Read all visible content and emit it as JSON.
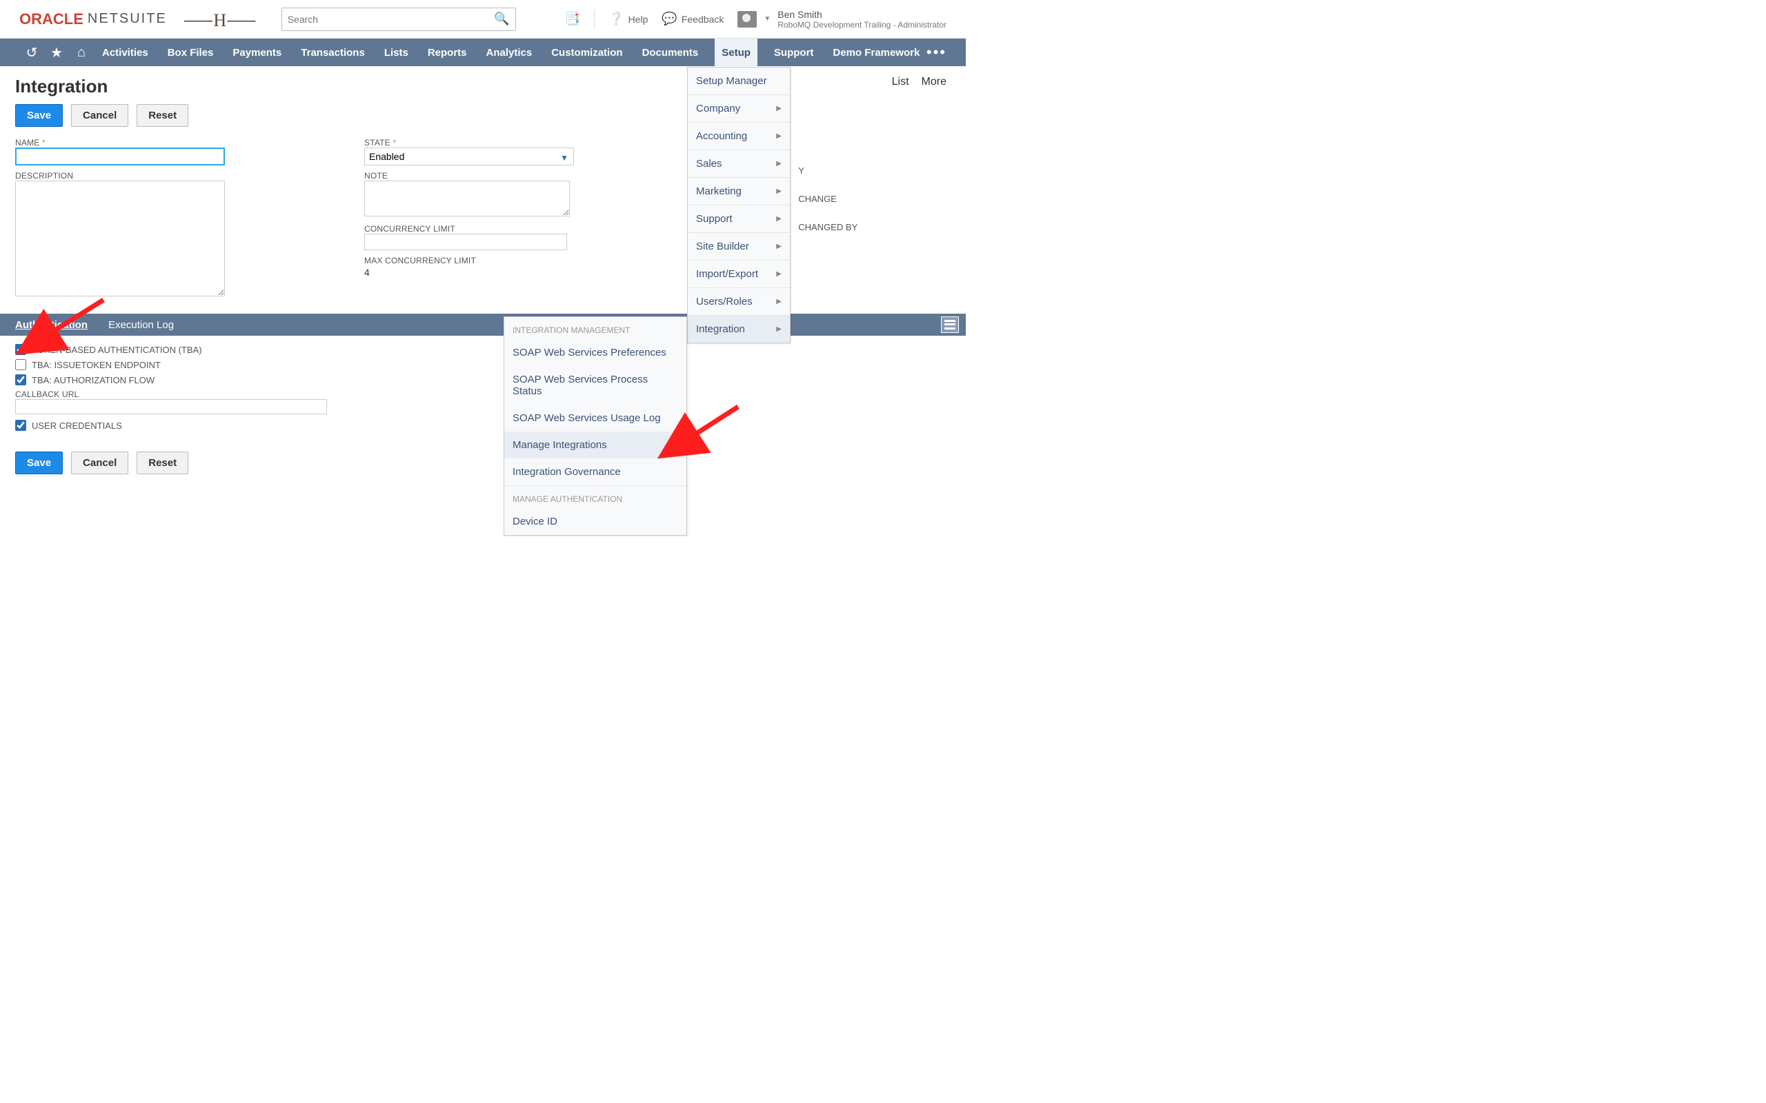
{
  "header": {
    "logo_oracle": "ORACLE",
    "logo_netsuite": "NETSUITE",
    "search_placeholder": "Search",
    "help_label": "Help",
    "feedback_label": "Feedback",
    "user_name": "Ben Smith",
    "user_role": "RoboMQ Development Trailing - Administrator"
  },
  "nav": {
    "items": [
      "Activities",
      "Box Files",
      "Payments",
      "Transactions",
      "Lists",
      "Reports",
      "Analytics",
      "Customization",
      "Documents",
      "Setup",
      "Support",
      "Demo Framework"
    ],
    "active": "Setup"
  },
  "page_title": "Integration",
  "buttons": {
    "save": "Save",
    "cancel": "Cancel",
    "reset": "Reset"
  },
  "page_actions": {
    "list": "List",
    "more": "More"
  },
  "form": {
    "name": {
      "label": "NAME",
      "value": ""
    },
    "description": {
      "label": "DESCRIPTION",
      "value": ""
    },
    "state": {
      "label": "STATE",
      "value": "Enabled"
    },
    "note": {
      "label": "NOTE",
      "value": ""
    },
    "concurrency_limit": {
      "label": "CONCURRENCY LIMIT",
      "value": ""
    },
    "max_concurrency": {
      "label": "MAX CONCURRENCY LIMIT",
      "value": "4"
    }
  },
  "shadow": {
    "y": "Y",
    "change": "CHANGE",
    "changed_by": "CHANGED BY"
  },
  "tabs": {
    "auth": "Authentication",
    "exec": "Execution Log"
  },
  "auth": {
    "tba": "TOKEN-BASED AUTHENTICATION (TBA)",
    "issuetoken": "TBA: ISSUETOKEN ENDPOINT",
    "authflow": "TBA: AUTHORIZATION FLOW",
    "callback": "CALLBACK URL",
    "usercred": "USER CREDENTIALS"
  },
  "setup_menu": [
    "Setup Manager",
    "Company",
    "Accounting",
    "Sales",
    "Marketing",
    "Support",
    "Site Builder",
    "Import/Export",
    "Users/Roles",
    "Integration"
  ],
  "intmgmt": {
    "hdr1": "INTEGRATION MANAGEMENT",
    "items1": [
      "SOAP Web Services Preferences",
      "SOAP Web Services Process Status",
      "SOAP Web Services Usage Log",
      "Manage Integrations",
      "Integration Governance"
    ],
    "hdr2": "MANAGE AUTHENTICATION",
    "items2": [
      "Device ID"
    ]
  }
}
